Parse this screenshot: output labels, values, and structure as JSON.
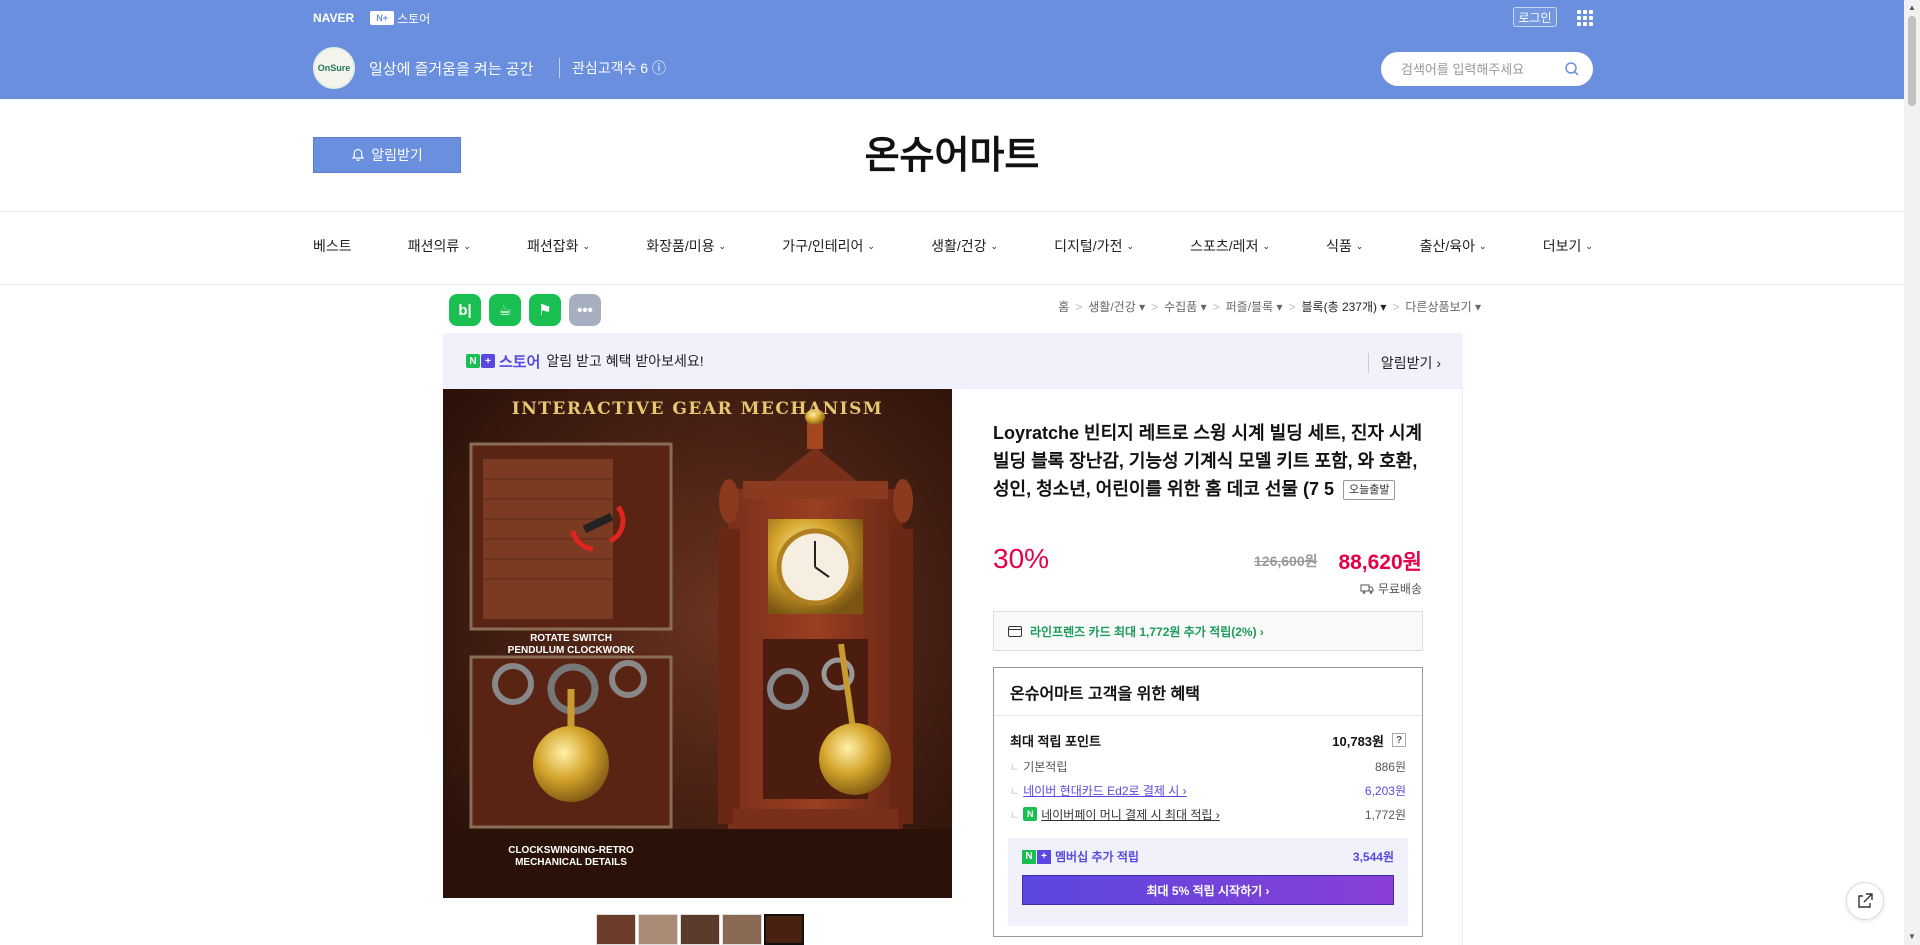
{
  "header": {
    "naver_logo": "NAVER",
    "nstore_badge": "N+",
    "nstore_label": "스토어",
    "login": "로그인",
    "store_logo_text": "OnSure",
    "slogan": "일상에 즐거움을 켜는 공간",
    "fans": "관심고객수 6 ⓘ",
    "search_placeholder": "검색어를 입력해주세요"
  },
  "store": {
    "alarm_button": "알림받기",
    "name": "온슈어마트"
  },
  "nav": [
    {
      "label": "베스트",
      "chevron": ""
    },
    {
      "label": "패션의류",
      "chevron": "⌄"
    },
    {
      "label": "패션잡화",
      "chevron": "⌄"
    },
    {
      "label": "화장품/미용",
      "chevron": "⌄"
    },
    {
      "label": "가구/인테리어",
      "chevron": "⌄"
    },
    {
      "label": "생활/건강",
      "chevron": "⌄"
    },
    {
      "label": "디지털/가전",
      "chevron": "⌄"
    },
    {
      "label": "스포츠/레저",
      "chevron": "⌄"
    },
    {
      "label": "식품",
      "chevron": "⌄"
    },
    {
      "label": "출산/육아",
      "chevron": "⌄"
    },
    {
      "label": "더보기",
      "chevron": "⌄"
    }
  ],
  "share_icons": [
    {
      "name": "blog-share-icon",
      "glyph": "b|",
      "color": "#19c051"
    },
    {
      "name": "cafe-share-icon",
      "glyph": "☕",
      "color": "#19c051"
    },
    {
      "name": "bookmark-share-icon",
      "glyph": "⚑",
      "color": "#19c051"
    },
    {
      "name": "more-share-icon",
      "glyph": "•••",
      "color": "#a7aebf"
    }
  ],
  "breadcrumb": [
    "홈",
    "생활/건강 ▾",
    "수집품 ▾",
    "퍼즐/블록 ▾",
    "블록(총 237개) ▾",
    "다른상품보기 ▾"
  ],
  "banner": {
    "store_label": "스토어",
    "text": "알림 받고 혜택 받아보세요!",
    "right": "알림받기 ›"
  },
  "product": {
    "image_headline": "INTERACTIVE GEAR MECHANISM",
    "image_caption1": "ROTATE SWITCH\nPENDULUM CLOCKWORK",
    "image_caption2": "CLOCKSWINGING-RETRO\nMECHANICAL DETAILS",
    "title": "Loyratche 빈티지 레트로 스윙 시계 빌딩 세트, 진자 시계 빌딩 블록 장난감, 기능성 기계식 모델 키트 포함, 와 호환, 성인, 청소년, 어린이를 위한 홈 데코 선물 (7 5",
    "today_badge": "오늘출발",
    "discount": "30%",
    "original_price": "126,600원",
    "sale_price": "88,620원",
    "delivery": "무료배송",
    "card_benefit": "라인프렌즈 카드 최대 1,772원 추가 적립(2%) ›"
  },
  "benefit": {
    "title": "온슈어마트 고객을 위한 혜택",
    "max_points_label": "최대 적립 포인트",
    "max_points_value": "10,783원",
    "qmark": "?",
    "rows": [
      {
        "label": "기본적립",
        "value": "886원",
        "style": "plain"
      },
      {
        "label": "네이버 현대카드 Ed2로 결제 시 ›",
        "value": "6,203원",
        "style": "link"
      },
      {
        "label": "네이버페이 머니 결제 시 최대 적립 ›",
        "value": "1,772원",
        "style": "link2"
      }
    ],
    "member_label": "멤버십 추가 적립",
    "member_value": "3,544원",
    "member_button": "최대 5% 적립 시작하기 ›"
  },
  "colors": {
    "header_blue": "#6a8fde",
    "price_red": "#e5004a",
    "naver_green": "#19c051",
    "purple": "#5a47df"
  }
}
